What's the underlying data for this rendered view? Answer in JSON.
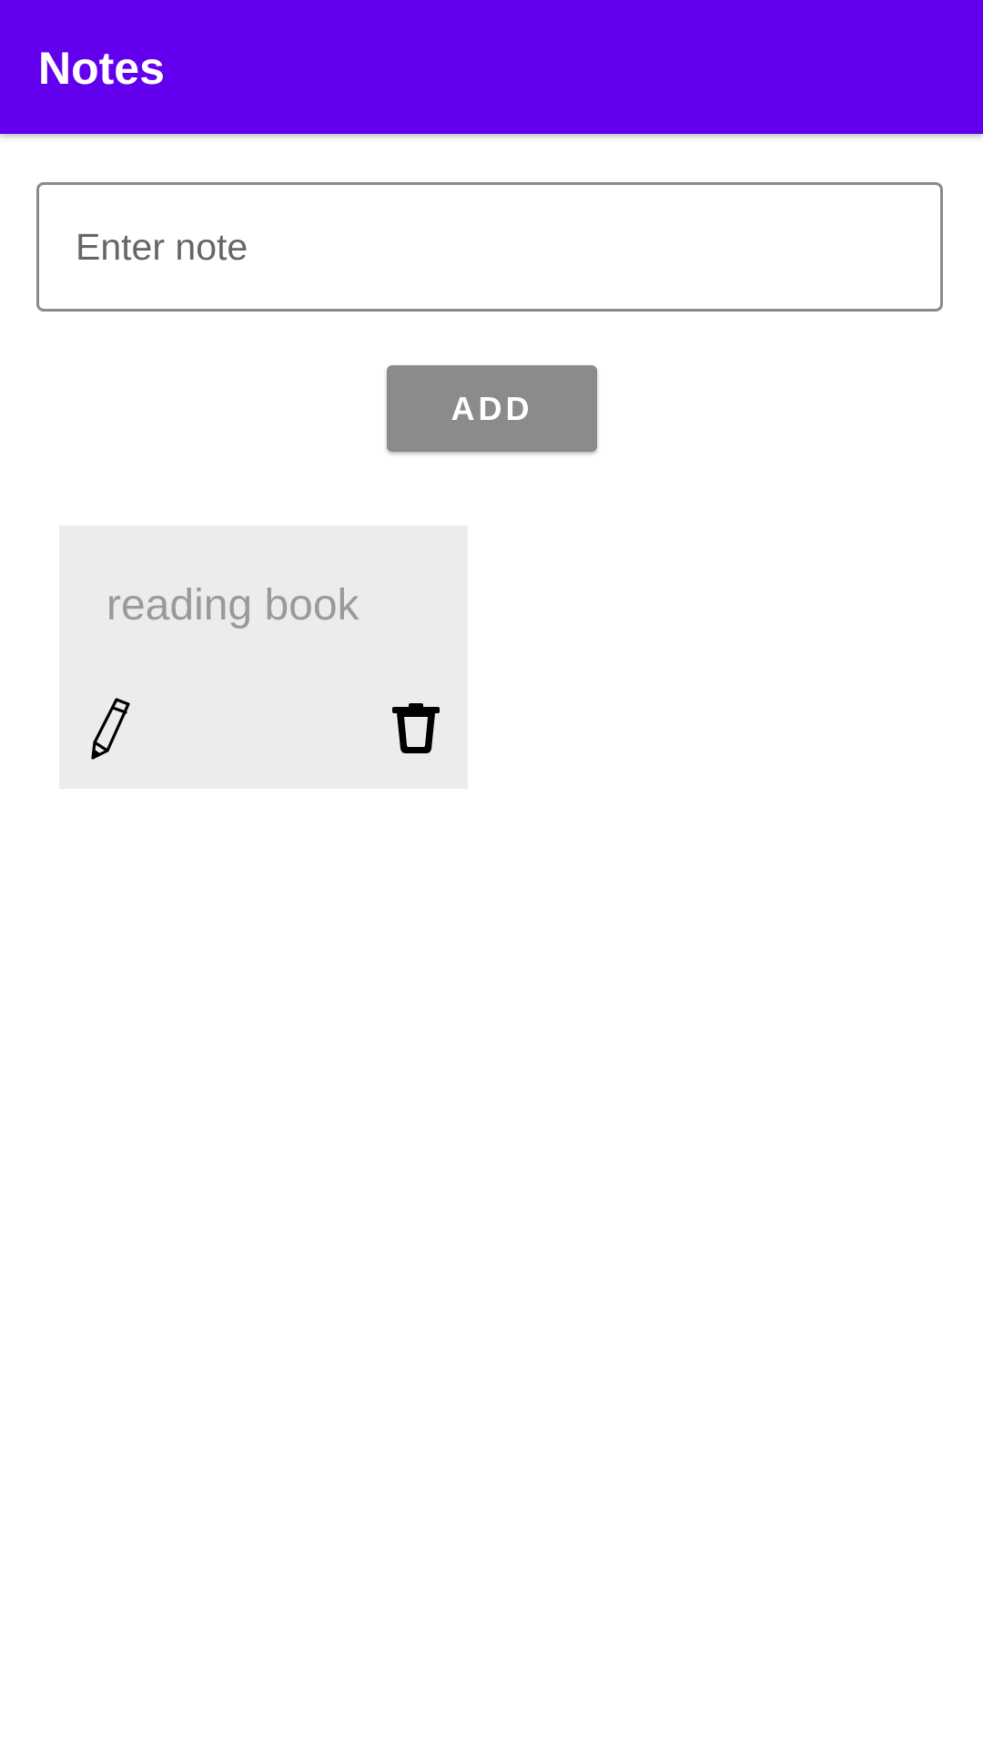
{
  "app_bar": {
    "title": "Notes",
    "color": "#6200ee"
  },
  "input": {
    "value": "",
    "placeholder": "Enter note"
  },
  "add_button": {
    "label": "ADD"
  },
  "notes": [
    {
      "text": "reading book",
      "edit_icon": "pencil-icon",
      "delete_icon": "trash-icon"
    }
  ]
}
